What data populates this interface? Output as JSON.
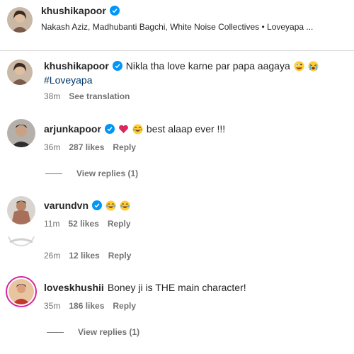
{
  "header": {
    "username": "khushikapoor",
    "subtitle": "Nakash Aziz, Madhubanti Bagchi, White Noise Collectives • Loveyapa ..."
  },
  "caption": {
    "username": "khushikapoor",
    "text": "Nikla tha love karne par papa aagaya",
    "emojis": [
      "zany-face",
      "loudly-crying-face"
    ],
    "hashtag": "#Loveyapa",
    "time": "38m",
    "see_translation": "See translation"
  },
  "comments": [
    {
      "username": "arjunkapoor",
      "verified": true,
      "emojis": [
        "red-heart",
        "tears-of-joy"
      ],
      "text": "best alaap ever !!!",
      "time": "36m",
      "likes": "287 likes",
      "reply": "Reply",
      "view_replies": "View replies (1)"
    },
    {
      "username": "varundvn",
      "verified": true,
      "emojis": [
        "tears-of-joy",
        "tears-of-joy"
      ],
      "text": "",
      "time": "11m",
      "likes": "52 likes",
      "reply": "Reply"
    },
    {
      "time": "26m",
      "likes": "12 likes",
      "reply": "Reply"
    },
    {
      "username": "loveskhushii",
      "verified": false,
      "text": "Boney ji is THE main character!",
      "time": "35m",
      "likes": "186 likes",
      "reply": "Reply",
      "view_replies": "View replies (1)"
    }
  ],
  "colors": {
    "verified_blue": "#0095f6",
    "text": "#262626",
    "meta": "#737373",
    "hashtag": "#00376b",
    "story_ring": "#d6249f"
  }
}
